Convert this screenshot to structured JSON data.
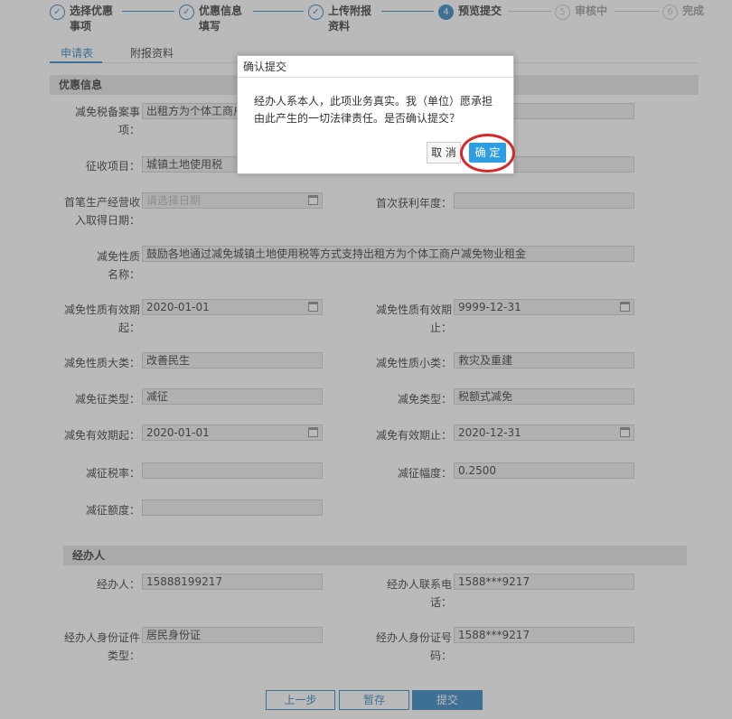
{
  "steps": [
    {
      "line1": "选择优惠",
      "line2": "事项",
      "icon": "check-icon",
      "mark": "✓"
    },
    {
      "line1": "优惠信息",
      "line2": "填写",
      "icon": "check-icon",
      "mark": "✓"
    },
    {
      "line1": "上传附报",
      "line2": "资料",
      "icon": "check-icon",
      "mark": "✓"
    },
    {
      "line1": "预览提交",
      "line2": "",
      "icon": "number-4-icon",
      "mark": "4"
    },
    {
      "line1": "审核中",
      "line2": "",
      "icon": "number-5-icon",
      "mark": "5"
    },
    {
      "line1": "完成",
      "line2": "",
      "icon": "number-6-icon",
      "mark": "6"
    }
  ],
  "tabs": [
    "申请表",
    "附报资料"
  ],
  "sections": {
    "preferential": "优惠信息",
    "agent": "经办人"
  },
  "form": {
    "filing_item": {
      "label1": "减免税备案事",
      "label2": "项：",
      "value": "出租方为个体工商户"
    },
    "levy_item": {
      "label": "征收项目：",
      "value": "城镇土地使用税"
    },
    "first_income_date": {
      "label1": "首笔生产经营收",
      "label2": "入取得日期：",
      "placeholder": "请选择日期"
    },
    "first_profit_year": {
      "label": "首次获利年度："
    },
    "nature_name": {
      "label1": "减免性质",
      "label2": "名称：",
      "value": "鼓励各地通过减免城镇土地使用税等方式支持出租方为个体工商户减免物业租金"
    },
    "nature_valid_from": {
      "label1": "减免性质有效期",
      "label2": "起：",
      "value": "2020-01-01"
    },
    "nature_valid_to": {
      "label1": "减免性质有效期",
      "label2": "止：",
      "value": "9999-12-31"
    },
    "nature_major": {
      "label": "减免性质大类：",
      "value": "改善民生"
    },
    "nature_minor": {
      "label": "减免性质小类：",
      "value": "救灾及重建"
    },
    "cert_type": {
      "label": "减免征类型：",
      "value": "减征"
    },
    "relief_type": {
      "label": "减免类型：",
      "value": "税额式减免"
    },
    "valid_from": {
      "label": "减免有效期起：",
      "value": "2020-01-01"
    },
    "valid_to": {
      "label": "减免有效期止：",
      "value": "2020-12-31"
    },
    "rate": {
      "label": "减征税率："
    },
    "range": {
      "label": "减征幅度：",
      "value": "0.2500"
    },
    "amount": {
      "label": "减征额度："
    },
    "agent": {
      "label": "经办人：",
      "value": "15888199217"
    },
    "agent_phone": {
      "label1": "经办人联系电",
      "label2": "话：",
      "value": "1588***9217"
    },
    "agent_id_type": {
      "label1": "经办人身份证件",
      "label2": "类型：",
      "value": "居民身份证"
    },
    "agent_id_no": {
      "label1": "经办人身份证号",
      "label2": "码：",
      "value": "1588***9217"
    }
  },
  "buttons": {
    "prev": "上一步",
    "save": "暂存",
    "submit": "提交"
  },
  "modal": {
    "title": "确认提交",
    "message": "经办人系本人，此项业务真实。我（单位）愿承担由此产生的一切法律责任。是否确认提交？",
    "cancel": "取 消",
    "ok": "确 定"
  },
  "colors": {
    "accent": "#2a7fc0",
    "ok_button": "#2e9ee2",
    "highlight_ring": "#d42a2a"
  }
}
